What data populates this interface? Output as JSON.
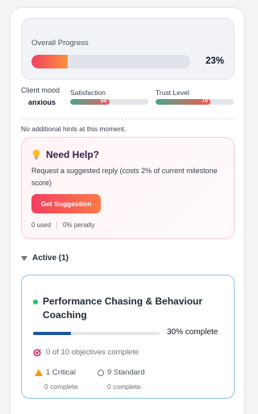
{
  "progress": {
    "label": "Overall Progress",
    "percent_text": "23%",
    "value": 23
  },
  "mood": {
    "label": "Client mood",
    "value": "anxious"
  },
  "metrics": {
    "satisfaction": {
      "label": "Satisfaction",
      "value": 50,
      "value_text": "50"
    },
    "trust": {
      "label": "Trust Level",
      "value": 70,
      "value_text": "70"
    }
  },
  "hint": "No additional hints at this moment.",
  "help": {
    "icon": "lightbulb-icon",
    "title": "Need Help?",
    "description": "Request a suggested reply (costs 2% of current milestone score)",
    "button_label": "Get Suggestion",
    "used": "0 used",
    "penalty": "0% penalty"
  },
  "active_section": {
    "label": "Active (1)"
  },
  "objective": {
    "title": "Performance Chasing & Behaviour Coaching",
    "percent_text": "30% complete",
    "value": 30,
    "objectives_text": "0 of 10 objectives complete",
    "critical": {
      "label": "1 Critical",
      "sub": "0 complete"
    },
    "standard": {
      "label": "9 Standard",
      "sub": "0 complete"
    }
  },
  "colors": {
    "accent": "#f43f5e",
    "accent2": "#fb923c",
    "blue": "#1e56a0",
    "card_border": "#8ec5ea"
  }
}
